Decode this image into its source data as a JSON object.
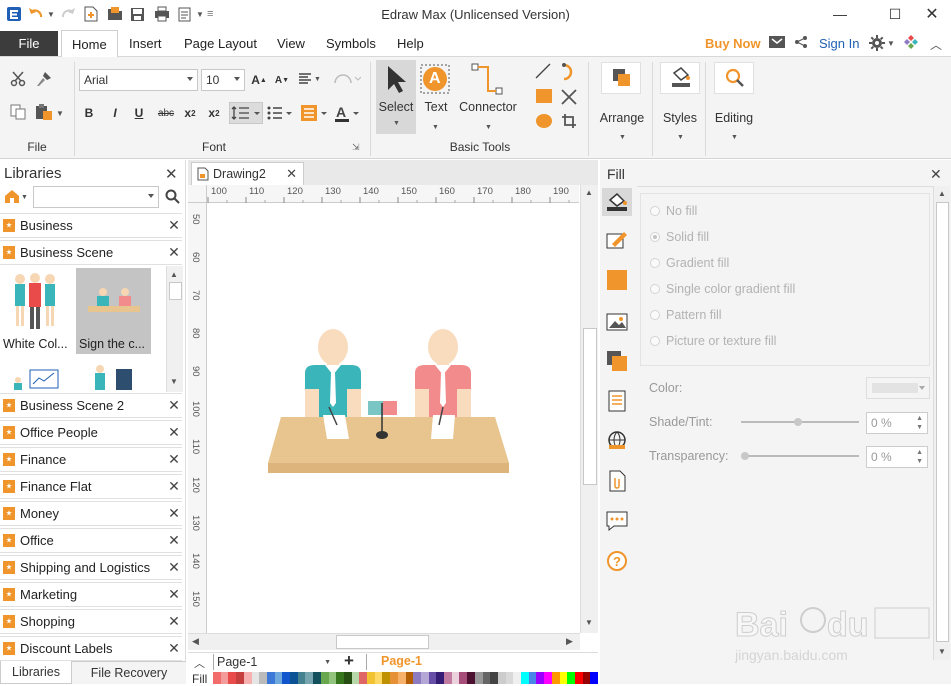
{
  "window": {
    "title": "Edraw Max (Unlicensed Version)"
  },
  "menu": {
    "file": "File",
    "tabs": [
      "Home",
      "Insert",
      "Page Layout",
      "View",
      "Symbols",
      "Help"
    ],
    "buy_now": "Buy Now",
    "sign_in": "Sign In"
  },
  "ribbon": {
    "file_group": "File",
    "font_group": "Font",
    "font_name": "Arial",
    "font_size": "10",
    "basic_tools_group": "Basic Tools",
    "select": "Select",
    "text": "Text",
    "connector": "Connector",
    "arrange": "Arrange",
    "styles": "Styles",
    "editing": "Editing",
    "text_icon_letter": "A"
  },
  "libraries": {
    "title": "Libraries",
    "search_placeholder": "",
    "items_top": [
      "Business",
      "Business Scene"
    ],
    "thumbs": [
      "White Col...",
      "Sign the c..."
    ],
    "items": [
      "Business Scene 2",
      "Office People",
      "Finance",
      "Finance Flat",
      "Money",
      "Office",
      "Shipping and Logistics",
      "Marketing",
      "Shopping",
      "Discount Labels"
    ],
    "bottom_tabs": [
      "Libraries",
      "File Recovery"
    ]
  },
  "document": {
    "tab": "Drawing2",
    "ruler_top": [
      "100",
      "110",
      "120",
      "130",
      "140",
      "150",
      "160",
      "170",
      "180",
      "190"
    ],
    "ruler_left": [
      "50",
      "60",
      "70",
      "80",
      "90",
      "100",
      "110",
      "120",
      "130",
      "140",
      "150"
    ],
    "page_select": "Page-1",
    "active_page": "Page-1",
    "fill_label": "Fill"
  },
  "fill_panel": {
    "title": "Fill",
    "options": [
      "No fill",
      "Solid fill",
      "Gradient fill",
      "Single color gradient fill",
      "Pattern fill",
      "Picture or texture fill"
    ],
    "selected_option": "Solid fill",
    "color_label": "Color:",
    "shade_label": "Shade/Tint:",
    "shade_value": "0 %",
    "transparency_label": "Transparency:",
    "transparency_value": "0 %"
  },
  "colors": {
    "accent_orange": "#f0952b",
    "file_tab": "#3c3c3c",
    "sign_in_blue": "#1f5fb4",
    "teal_shirt": "#3ab5b9",
    "pink_shirt": "#f28b8b",
    "desk": "#e8c48e"
  },
  "palette": [
    "#f26c6c",
    "#f49b9b",
    "#e94b4b",
    "#c63f3f",
    "#f6b0b0",
    "#e5e5e5",
    "#bbbbbb",
    "#3c78d8",
    "#6fa8dc",
    "#1155cc",
    "#0b5394",
    "#45818e",
    "#76a5af",
    "#134f5c",
    "#6aa84f",
    "#93c47d",
    "#38761d",
    "#274e13",
    "#b6d7a8",
    "#e06666",
    "#f1c232",
    "#ffd966",
    "#bf9000",
    "#e69138",
    "#f6b26b",
    "#b45f06",
    "#8e7cc3",
    "#b4a7d6",
    "#674ea7",
    "#351c75",
    "#c27ba0",
    "#ead1dc",
    "#a64d79",
    "#4c1130",
    "#999999",
    "#666666",
    "#434343",
    "#cccccc",
    "#d9d9d9",
    "#efefef",
    "#00ffff",
    "#4a86e8",
    "#9900ff",
    "#ff00ff",
    "#ff9900",
    "#ffff00",
    "#00ff00",
    "#ff0000",
    "#980000",
    "#0000ff"
  ]
}
